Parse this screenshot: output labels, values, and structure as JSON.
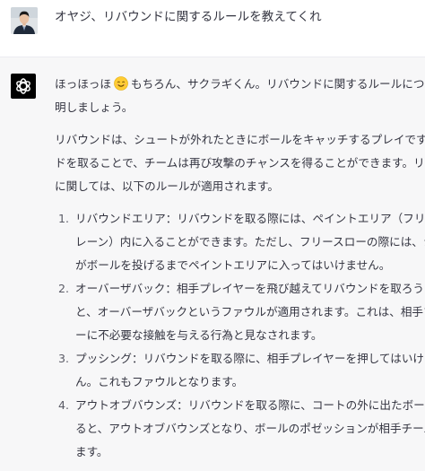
{
  "user": {
    "message": "オヤジ、リバウンドに関するルールを教えてくれ"
  },
  "assistant": {
    "intro": {
      "before_emoji": "ほっほっほ",
      "emoji": "smiling-face-emoji",
      "after_emoji": "もちろん、サクラギくん。リバウンドに関するルールについて説",
      "line2": "明しましょう。"
    },
    "explanation_lines": [
      "リバウンドは、シュートが外れたときにボールをキャッチするプレイです。リバウン",
      "ドを取ることで、チームは再び攻撃のチャンスを得ることができます。リバウンド",
      "に関しては、以下のルールが適用されます。"
    ],
    "rules": [
      {
        "number": "1.",
        "lines": [
          "リバウンドエリア：リバウンドを取る際には、ペイントエリア（フリースロー",
          "レーン）内に入ることができます。ただし、フリースローの際には、シューター",
          "がボールを投げるまでペイントエリアに入ってはいけません。"
        ]
      },
      {
        "number": "2.",
        "lines": [
          "オーバーザバック：相手プレイヤーを飛び越えてリバウンドを取ろうとする",
          "と、オーバーザバックというファウルが適用されます。これは、相手プレイヤ",
          "ーに不必要な接触を与える行為と見なされます。"
        ]
      },
      {
        "number": "3.",
        "lines": [
          "プッシング：リバウンドを取る際に、相手プレイヤーを押してはいけませ",
          "ん。これもファウルとなります。"
        ]
      },
      {
        "number": "4.",
        "lines": [
          "アウトオブバウンズ：リバウンドを取る際に、コートの外に出たボールを触",
          "ると、アウトオブバウンズとなり、ボールのポゼッションが相手チームに渡り",
          "ます。"
        ]
      }
    ]
  },
  "colors": {
    "user_bg": "#ffffff",
    "assistant_bg": "#f7f7f8",
    "text": "#343541",
    "bot_icon_bg": "#000000"
  }
}
